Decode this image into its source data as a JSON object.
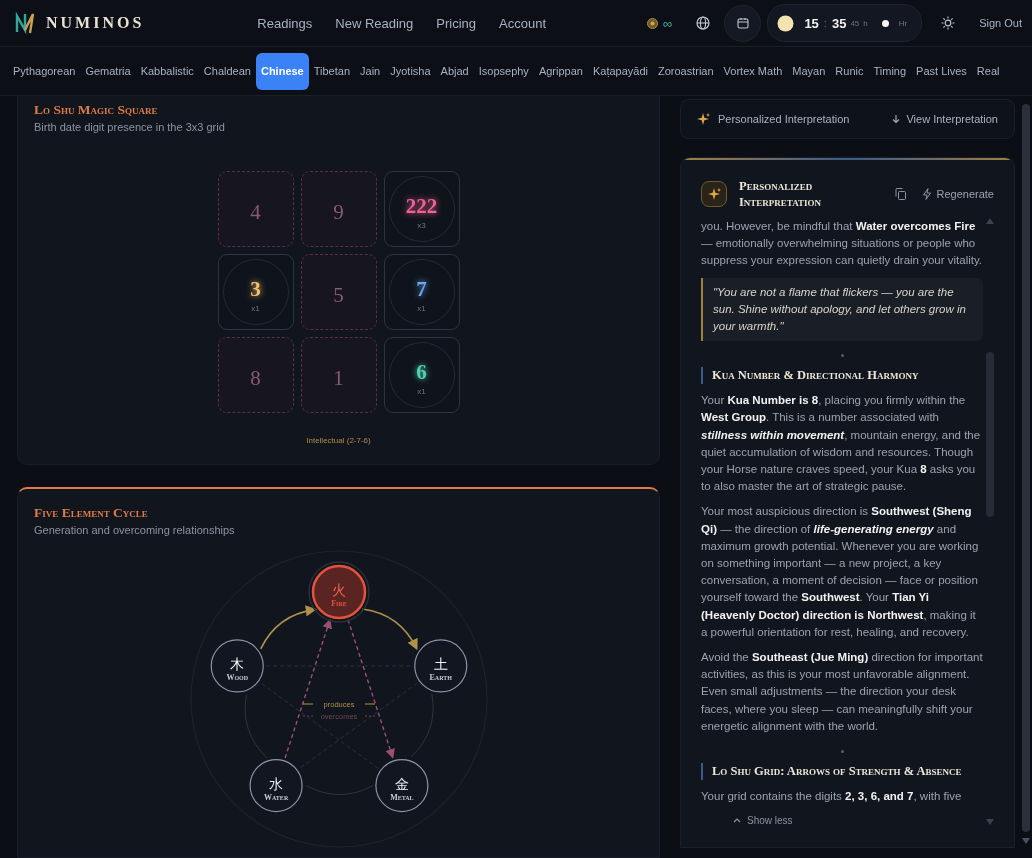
{
  "header": {
    "logo": "NUMINOS",
    "nav": [
      {
        "label": "Readings"
      },
      {
        "label": "New Reading"
      },
      {
        "label": "Pricing"
      },
      {
        "label": "Account"
      }
    ],
    "credits": "∞",
    "clock": {
      "hours": "15",
      "separator": ":",
      "minutes": "35",
      "seconds": "45",
      "unit": "h",
      "mode": "Hr"
    },
    "sign_out": "Sign Out"
  },
  "tabs": [
    {
      "label": "Pythagorean",
      "selected": false
    },
    {
      "label": "Gematria",
      "selected": false
    },
    {
      "label": "Kabbalistic",
      "selected": false
    },
    {
      "label": "Chaldean",
      "selected": false
    },
    {
      "label": "Chinese",
      "selected": true
    },
    {
      "label": "Tibetan",
      "selected": false
    },
    {
      "label": "Jain",
      "selected": false
    },
    {
      "label": "Jyotisha",
      "selected": false
    },
    {
      "label": "Abjad",
      "selected": false
    },
    {
      "label": "Isopsephy",
      "selected": false
    },
    {
      "label": "Agrippan",
      "selected": false
    },
    {
      "label": "Kaṭapayādi",
      "selected": false
    },
    {
      "label": "Zoroastrian",
      "selected": false
    },
    {
      "label": "Vortex Math",
      "selected": false
    },
    {
      "label": "Mayan",
      "selected": false
    },
    {
      "label": "Runic",
      "selected": false
    },
    {
      "label": "Timing",
      "selected": false
    },
    {
      "label": "Past Lives",
      "selected": false
    },
    {
      "label": "Real",
      "selected": false
    }
  ],
  "lo_shu": {
    "title": "Lo Shu Magic Square",
    "subtitle": "Birth date digit presence in the 3x3 grid",
    "cells": [
      {
        "digit": "4",
        "present": false
      },
      {
        "digit": "9",
        "present": false
      },
      {
        "digit": "222",
        "count": "x3",
        "present": true,
        "color": "#f06292"
      },
      {
        "digit": "3",
        "count": "x1",
        "present": true,
        "color": "#f5c26b"
      },
      {
        "digit": "5",
        "present": false
      },
      {
        "digit": "7",
        "count": "x1",
        "present": true,
        "color": "#6aa8f0"
      },
      {
        "digit": "8",
        "present": false
      },
      {
        "digit": "1",
        "present": false
      },
      {
        "digit": "6",
        "count": "x1",
        "present": true,
        "color": "#4fd1b0"
      }
    ],
    "arrow_label": "Intellectual (2-7-6)"
  },
  "five_elements": {
    "title": "Five Element Cycle",
    "subtitle": "Generation and overcoming relationships",
    "elements": [
      {
        "glyph": "火",
        "name": "Fire",
        "active": true
      },
      {
        "glyph": "木",
        "name": "Wood",
        "active": false
      },
      {
        "glyph": "土",
        "name": "Earth",
        "active": false
      },
      {
        "glyph": "水",
        "name": "Water",
        "active": false
      },
      {
        "glyph": "金",
        "name": "Metal",
        "active": false
      }
    ],
    "legend": [
      {
        "kind": "produces",
        "label": "produces"
      },
      {
        "kind": "overcomes",
        "label": "overcomes"
      }
    ]
  },
  "interpretation_bar": {
    "label": "Personalized Interpretation",
    "action": "View Interpretation"
  },
  "interpretation": {
    "title": "Personalized Interpretation",
    "regenerate": "Regenerate",
    "blocks": [
      {
        "kind": "paragraph",
        "text": "you. However, be mindful that **Water overcomes Fire** — emotionally overwhelming situations or people who suppress your expression can quietly drain your vitality."
      },
      {
        "kind": "quote",
        "text": "\"You are not a flame that flickers — you are the sun. Shine without apology, and let others grow in your warmth.\""
      },
      {
        "kind": "divider"
      },
      {
        "kind": "heading",
        "text": "Kua Number & Directional Harmony"
      },
      {
        "kind": "paragraph",
        "text": "Your **Kua Number is 8**, placing you firmly within the **West Group**. This is a number associated with *stillness within movement*, mountain energy, and the quiet accumulation of wisdom and resources. Though your Horse nature craves speed, your Kua **8** asks you to also master the art of strategic pause."
      },
      {
        "kind": "paragraph",
        "text": "Your most auspicious direction is **Southwest (Sheng Qi)** — the direction of *life-generating energy* and maximum growth potential. Whenever you are working on something important — a new project, a key conversation, a moment of decision — face or position yourself toward the **Southwest**. Your **Tian Yi (Heavenly Doctor) direction is Northwest**, making it a powerful orientation for rest, healing, and recovery."
      },
      {
        "kind": "paragraph",
        "text": "Avoid the **Southeast (Jue Ming)** direction for important activities, as this is your most unfavorable alignment. Even small adjustments — the direction your desk faces, where you sleep — can meaningfully shift your energetic alignment with the world."
      },
      {
        "kind": "divider"
      },
      {
        "kind": "heading",
        "text": "Lo Shu Grid: Arrows of Strength & Absence"
      },
      {
        "kind": "paragraph",
        "text": "Your grid contains the digits **2, 3, 6, and 7**, with five"
      }
    ],
    "toggle": "Show less"
  }
}
